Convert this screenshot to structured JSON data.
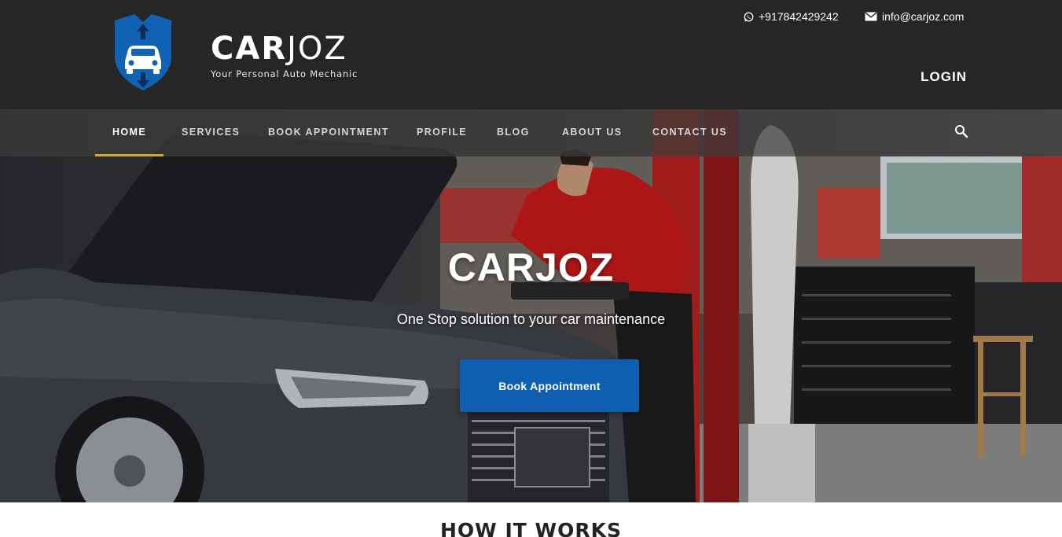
{
  "brand": {
    "name_bold": "CAR",
    "name_light": "JOZ",
    "tagline": "Your Personal Auto Mechanic"
  },
  "contact": {
    "phone": "+917842429242",
    "email": "info@carjoz.com"
  },
  "header": {
    "login_label": "LOGIN"
  },
  "nav": {
    "items": [
      {
        "label": "HOME",
        "active": true
      },
      {
        "label": "SERVICES",
        "active": false
      },
      {
        "label": "BOOK APPOINTMENT",
        "active": false
      },
      {
        "label": "PROFILE",
        "active": false
      },
      {
        "label": "BLOG",
        "active": false
      },
      {
        "label": "ABOUT US",
        "active": false
      },
      {
        "label": "CONTACT US",
        "active": false
      }
    ]
  },
  "hero": {
    "title": "CARJOZ",
    "subtitle": "One Stop solution to your car maintenance",
    "cta_label": "Book Appointment"
  },
  "section": {
    "how_it_works_title": "HOW IT WORKS"
  },
  "colors": {
    "header_bg": "#262626",
    "accent_underline": "#d6a53a",
    "cta_blue": "#0f5fb1",
    "logo_blue": "#1262b3"
  },
  "icons": {
    "phone": "whatsapp-icon",
    "email": "envelope-icon",
    "search": "search-icon",
    "logo": "car-shield-logo"
  }
}
